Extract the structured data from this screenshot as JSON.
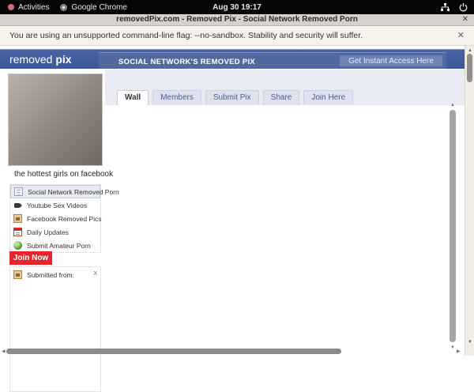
{
  "system_bar": {
    "activities_label": "Activities",
    "app_label": "Google Chrome",
    "clock": "Aug 30 19:17"
  },
  "window": {
    "title": "removedPix.com - Removed Pix - Social Network Removed Porn",
    "close_glyph": "✕"
  },
  "infobar": {
    "message": "You are using an unsupported command-line flag: --no-sandbox. Stability and security will suffer.",
    "close_glyph": "✕"
  },
  "site": {
    "logo_part1": "removed ",
    "logo_part2": "pix",
    "banner_text": "SOCIAL NETWORK'S REMOVED PIX",
    "access_label": "Get Instant Access Here",
    "photo_caption": "the hottest girls on facebook",
    "tabs": [
      {
        "label": "Wall",
        "active": true
      },
      {
        "label": "Members",
        "active": false
      },
      {
        "label": "Submit Pix",
        "active": false
      },
      {
        "label": "Share",
        "active": false
      },
      {
        "label": "Join Here",
        "active": false
      }
    ],
    "menu": [
      {
        "label": "Social Network Removed Porn",
        "icon": "note-icon",
        "active": true
      },
      {
        "label": "Youtube Sex Videos",
        "icon": "camera-icon",
        "active": false
      },
      {
        "label": "Facebook Removed Pics",
        "icon": "photo-icon",
        "active": false
      },
      {
        "label": "Daily Updates",
        "icon": "calendar-icon",
        "active": false
      },
      {
        "label": "Submit Amateur Porn",
        "icon": "globe-icon",
        "active": false
      }
    ],
    "join_label": "Join Now",
    "submitted_box": {
      "label": "Submitted from:",
      "close_glyph": "x"
    }
  },
  "scrollbars": {
    "up_glyph": "▲",
    "down_glyph": "▼",
    "left_glyph": "◀",
    "right_glyph": "▶"
  },
  "colors": {
    "header_blue": "#3b5998",
    "banner_blue": "#52699f",
    "access_blue": "#6d83b6",
    "strip_gray": "#e9ebf2",
    "active_item_bg": "#e9ebf3",
    "join_red": "#e8242b",
    "topbar_black": "#050505",
    "titlebar_gray": "#d6d2cb",
    "infobar_cream": "#f5f2ec"
  }
}
